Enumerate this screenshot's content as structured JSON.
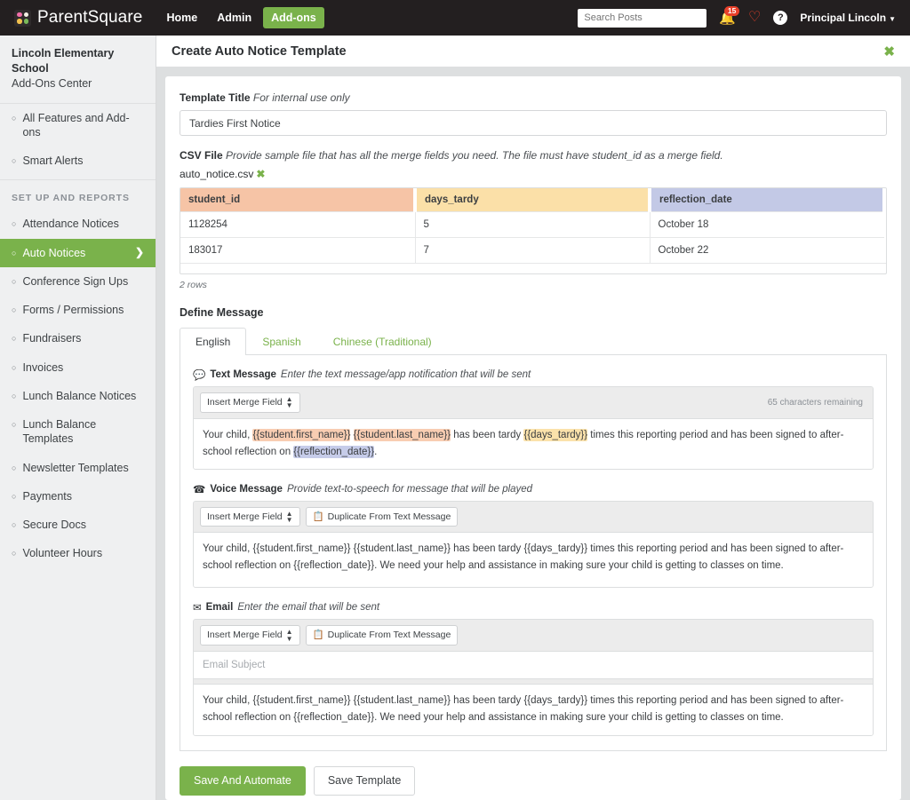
{
  "topnav": {
    "brand": "ParentSquare",
    "logo_icon": "parentsquare-logo-icon",
    "links": [
      {
        "label": "Home",
        "active": false
      },
      {
        "label": "Admin",
        "active": false
      },
      {
        "label": "Add-ons",
        "active": true
      }
    ],
    "search_placeholder": "Search Posts",
    "notifications_count": "15",
    "bell_icon": "bell-icon",
    "heart_icon": "heart-icon",
    "help_icon": "help-icon",
    "user": "Principal Lincoln",
    "caret_icon": "chevron-down-icon"
  },
  "sidebar": {
    "school_name": "Lincoln Elementary School",
    "school_sub": "Add-Ons Center",
    "top_items": [
      {
        "label": "All Features and Add-ons",
        "active": false
      },
      {
        "label": "Smart Alerts",
        "active": false
      }
    ],
    "section_label": "SET UP AND REPORTS",
    "items": [
      {
        "label": "Attendance Notices",
        "active": false
      },
      {
        "label": "Auto Notices",
        "active": true
      },
      {
        "label": "Conference Sign Ups",
        "active": false
      },
      {
        "label": "Forms / Permissions",
        "active": false
      },
      {
        "label": "Fundraisers",
        "active": false
      },
      {
        "label": "Invoices",
        "active": false
      },
      {
        "label": "Lunch Balance Notices",
        "active": false
      },
      {
        "label": "Lunch Balance Templates",
        "active": false
      },
      {
        "label": "Newsletter Templates",
        "active": false
      },
      {
        "label": "Payments",
        "active": false
      },
      {
        "label": "Secure Docs",
        "active": false
      },
      {
        "label": "Volunteer Hours",
        "active": false
      }
    ]
  },
  "main": {
    "page_title": "Create Auto Notice Template",
    "close_icon": "close-icon"
  },
  "template_title": {
    "label": "Template Title",
    "hint": "For internal use only",
    "value": "Tardies First Notice"
  },
  "csv": {
    "label": "CSV File",
    "hint": "Provide sample file that has all the merge fields you need. The file must have student_id as a merge field.",
    "file_name": "auto_notice.csv",
    "remove_icon": "remove-file-icon",
    "columns": [
      "student_id",
      "days_tardy",
      "reflection_date"
    ],
    "rows": [
      [
        "1128254",
        "5",
        "October 18"
      ],
      [
        "183017",
        "7",
        "October 22"
      ]
    ],
    "row_count_label": "2 rows",
    "header_colors": [
      "#f6c4a6",
      "#fbe0a8",
      "#c3c9e6"
    ]
  },
  "define_message": {
    "section_title": "Define Message",
    "tabs": [
      {
        "label": "English",
        "active": true
      },
      {
        "label": "Spanish",
        "active": false
      },
      {
        "label": "Chinese (Traditional)",
        "active": false
      }
    ],
    "text_message": {
      "icon": "chat-bubble-icon",
      "label": "Text Message",
      "hint": "Enter the text message/app notification that will be sent",
      "merge_button": "Insert Merge Field",
      "char_count": "65 characters remaining",
      "body_parts": [
        {
          "t": "Your child, ",
          "h": "none"
        },
        {
          "t": "{{student.first_name}}",
          "h": "peach"
        },
        {
          "t": " ",
          "h": "none"
        },
        {
          "t": "{{student.last_name}}",
          "h": "peach"
        },
        {
          "t": " has been tardy ",
          "h": "none"
        },
        {
          "t": "{{days_tardy}}",
          "h": "yellow"
        },
        {
          "t": " times this reporting period and has been signed to after-school reflection on ",
          "h": "none"
        },
        {
          "t": "{{reflection_date}}",
          "h": "blue"
        },
        {
          "t": ".",
          "h": "none"
        }
      ]
    },
    "voice_message": {
      "icon": "phone-icon",
      "label": "Voice Message",
      "hint": "Provide text-to-speech for message that will be played",
      "merge_button": "Insert Merge Field",
      "duplicate_button": "Duplicate From Text Message",
      "duplicate_icon": "copy-icon",
      "body": "Your child, {{student.first_name}} {{student.last_name}} has been tardy {{days_tardy}} times this reporting period and has been signed to after-school reflection on {{reflection_date}}. We need your help and assistance in making sure your child is getting to classes on time."
    },
    "email": {
      "icon": "envelope-icon",
      "label": "Email",
      "hint": "Enter the email that will be sent",
      "merge_button": "Insert Merge Field",
      "duplicate_button": "Duplicate From Text Message",
      "duplicate_icon": "copy-icon",
      "subject_placeholder": "Email Subject",
      "body": "Your child, {{student.first_name}} {{student.last_name}} has been tardy {{days_tardy}} times this reporting period and has been signed to after-school reflection on {{reflection_date}}. We need your help and assistance in making sure your child is getting to classes on time."
    }
  },
  "actions": {
    "primary": "Save And Automate",
    "secondary": "Save Template"
  },
  "colors": {
    "accent_green": "#7ab24b",
    "nav_dark": "#231f20",
    "badge_red": "#e8402a"
  }
}
